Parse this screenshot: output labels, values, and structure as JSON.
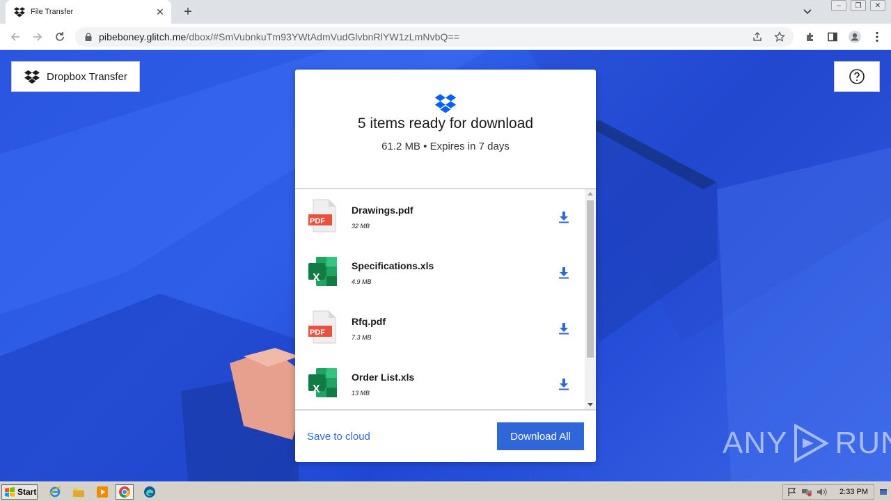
{
  "browser": {
    "tab_title": "File Transfer",
    "url_host": "pibeboney.glitch.me",
    "url_path": "/dbox/#SmVubnkuTm93YWtAdmVudGlvbnRlYW1zLmNvbQ=="
  },
  "page": {
    "brand_label": "Dropbox Transfer",
    "card": {
      "heading": "5 items ready for download",
      "subheading": "61.2 MB • Expires in 7 days",
      "files": [
        {
          "name": "Drawings.pdf",
          "size": "32 MB",
          "type": "pdf"
        },
        {
          "name": "Specifications.xls",
          "size": "4.9 MB",
          "type": "xls"
        },
        {
          "name": "Rfq.pdf",
          "size": "7.3 MB",
          "type": "pdf"
        },
        {
          "name": "Order List.xls",
          "size": "13 MB",
          "type": "xls"
        }
      ],
      "pdf_badge": "PDF",
      "xls_badge": "X",
      "save_to_cloud": "Save to cloud",
      "download_all": "Download All"
    },
    "watermark": {
      "left": "ANY",
      "right": "RUN"
    }
  },
  "taskbar": {
    "start_label": "Start",
    "clock": "2:33 PM"
  },
  "colors": {
    "accent": "#2f67d8",
    "dropbox_blue": "#0061fe",
    "pdf_red": "#e8533f",
    "excel_green": "#1d6f42"
  }
}
